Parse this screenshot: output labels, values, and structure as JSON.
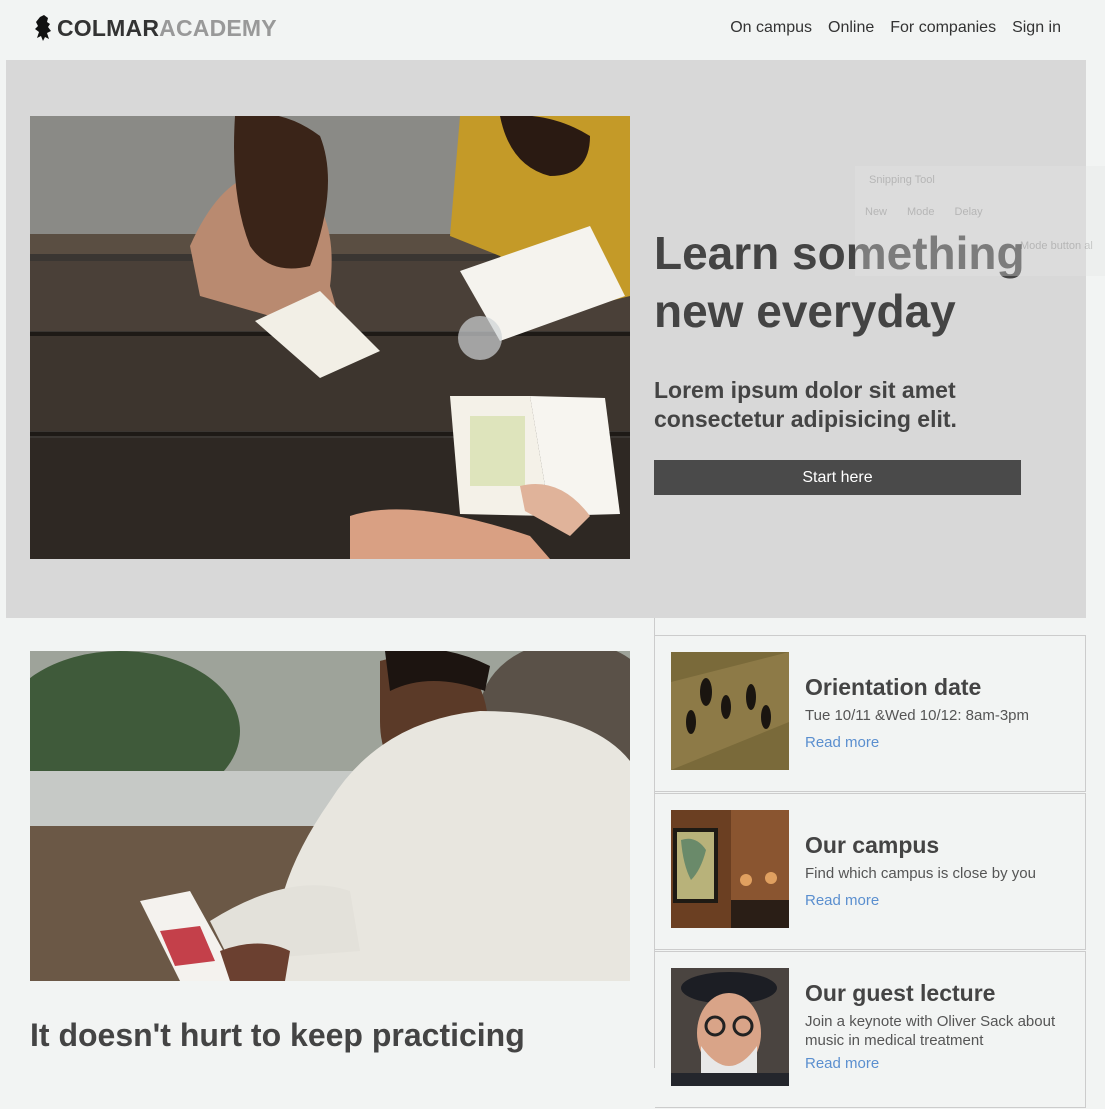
{
  "header": {
    "logo_strong": "COLMAR",
    "logo_light": "ACADEMY",
    "nav": [
      "On campus",
      "Online",
      "For companies",
      "Sign in"
    ]
  },
  "hero": {
    "title": "Learn something new everyday",
    "subtitle": "Lorem ipsum dolor sit amet consectetur adipisicing elit.",
    "button": "Start here"
  },
  "snipping_tool": {
    "title": "Snipping Tool",
    "new": "New",
    "mode": "Mode",
    "delay": "Delay",
    "note": "Mode button al"
  },
  "feature": {
    "title": "It doesn't hurt to keep practicing"
  },
  "cards": [
    {
      "title": "Orientation date",
      "text": "Tue 10/11 &Wed 10/12: 8am-3pm",
      "link": "Read more"
    },
    {
      "title": "Our campus",
      "text": "Find which campus is close by you",
      "link": "Read more"
    },
    {
      "title": "Our guest lecture",
      "text": "Join a keynote with Oliver Sack about music in medical treatment",
      "link": "Read more"
    }
  ],
  "colors": {
    "background": "#f2f4f3",
    "hero_bg": "#d8d8d8",
    "button_bg": "#4a4a4a",
    "link": "#5b8fcf",
    "text": "#444444"
  }
}
